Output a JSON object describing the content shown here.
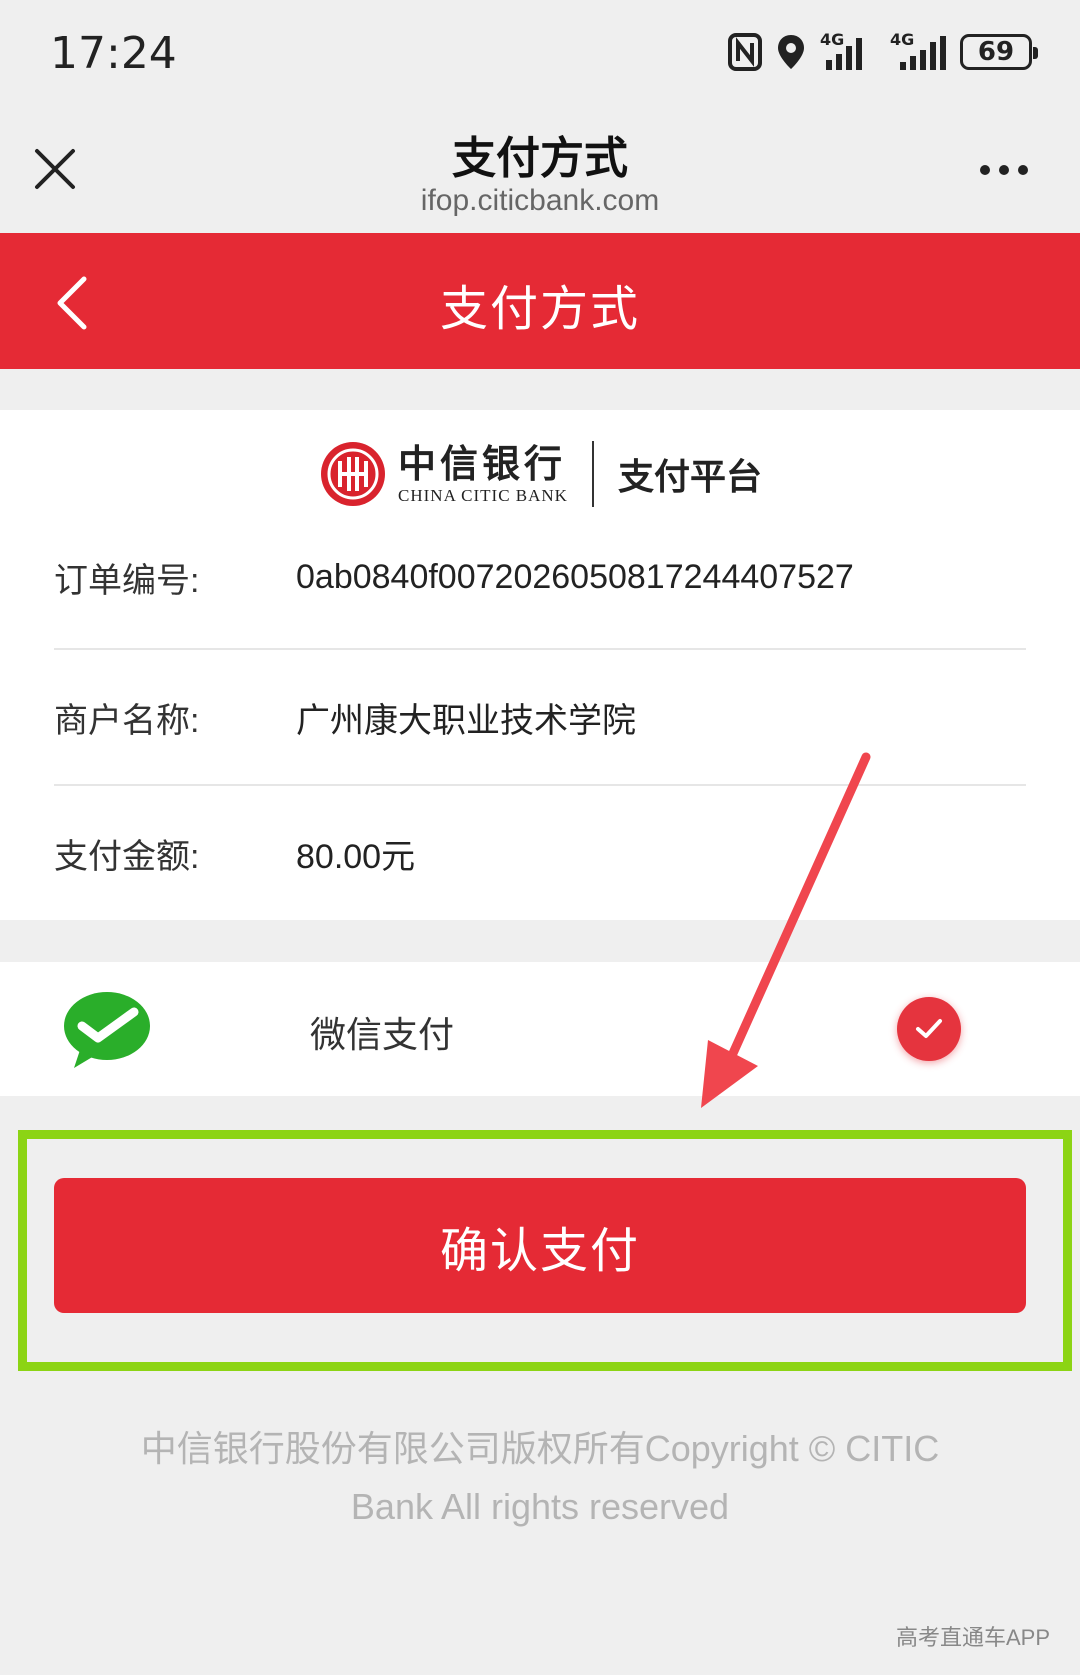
{
  "status_bar": {
    "time": "17:24",
    "network_1": "4G",
    "network_2": "4G",
    "battery": "69"
  },
  "titlebar": {
    "title": "支付方式",
    "url": "ifop.citicbank.com"
  },
  "header": {
    "title": "支付方式"
  },
  "brand": {
    "name_cn": "中信银行",
    "name_en": "CHINA CITIC BANK",
    "platform": "支付平台"
  },
  "order": {
    "rows": [
      {
        "label": "订单编号:",
        "value": "0ab0840f007202605081724440752​7"
      },
      {
        "label": "商户名称:",
        "value": "广州康大职业技术学院"
      },
      {
        "label": "支付金额:",
        "value": "80.00元"
      }
    ]
  },
  "payment_method": {
    "name": "微信支付",
    "selected": true
  },
  "confirm": {
    "label": "确认支付"
  },
  "footer": {
    "line1": "中信银行股份有限公司版权所有Copyright © CITIC",
    "line2": "Bank All rights reserved"
  },
  "watermark": "高考直通车APP",
  "colors": {
    "brand_red": "#e52a35",
    "highlight_green": "#8cd414",
    "wechat_green": "#2aae2a"
  }
}
